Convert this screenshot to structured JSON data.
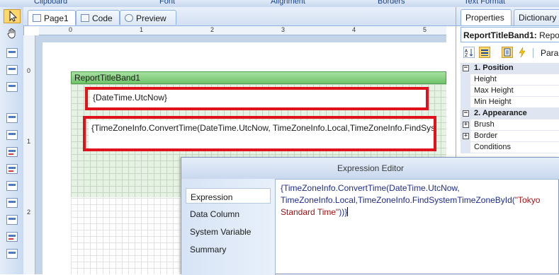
{
  "ribbon": {
    "groups": [
      "Clipboard",
      "Font",
      "Alignment",
      "Borders",
      "Text Format"
    ]
  },
  "toolbox": {
    "icons": [
      "pointer-tool-icon",
      "hand-tool-icon",
      "band-icon",
      "band-icon",
      "band-icon",
      "report-component-icon",
      "report-component-icon",
      "report-component-icon",
      "report-component-icon",
      "report-component-icon",
      "report-component-icon",
      "report-component-icon",
      "report-component-icon",
      "report-component-icon"
    ]
  },
  "tabs": [
    {
      "label": "Page1",
      "icon": "page-icon"
    },
    {
      "label": "Code",
      "icon": "code-icon"
    },
    {
      "label": "Preview",
      "icon": "preview-icon"
    }
  ],
  "ruler": {
    "horizontal": [
      "0",
      "1",
      "2",
      "3",
      "4",
      "5"
    ],
    "vertical": [
      "0",
      "1",
      "2"
    ]
  },
  "band": {
    "title": "ReportTitleBand1",
    "text1": "{DateTime.UtcNow}",
    "text2": "{TimeZoneInfo.ConvertTime(DateTime.UtcNow, TimeZoneInfo.Local,TimeZoneInfo.FindSystemTimeZoneById(\"Tokyo Standard Time\"))}"
  },
  "properties": {
    "tabs": [
      "Properties",
      "Dictionary"
    ],
    "object_name": "ReportTitleBand1:",
    "object_type": " Repo",
    "toolbar_extra": "Para",
    "rows": [
      {
        "label": "1. Position",
        "category": true,
        "expander": "−"
      },
      {
        "label": "Height",
        "category": false,
        "expander": ""
      },
      {
        "label": "Max Height",
        "category": false,
        "expander": ""
      },
      {
        "label": "Min Height",
        "category": false,
        "expander": ""
      },
      {
        "label": "2. Appearance",
        "category": true,
        "expander": "−"
      },
      {
        "label": "Brush",
        "category": false,
        "expander": "+"
      },
      {
        "label": "Border",
        "category": false,
        "expander": "+"
      },
      {
        "label": "Conditions",
        "category": false,
        "expander": ""
      }
    ]
  },
  "editor": {
    "title": "Expression Editor",
    "side_items": [
      "Expression",
      "Data Column",
      "System Variable",
      "Summary"
    ],
    "expression_code": "{TimeZoneInfo.ConvertTime(DateTime.UtcNow,\nTimeZoneInfo.Local,TimeZoneInfo.FindSystemTimeZoneById(",
    "expression_string": "\"Tokyo\nStandard Time\"",
    "expression_end": "))}"
  },
  "colors": {
    "highlight_frame": "#e0121b",
    "band_header": "#6fc46a",
    "accent": "#8db2e3"
  }
}
